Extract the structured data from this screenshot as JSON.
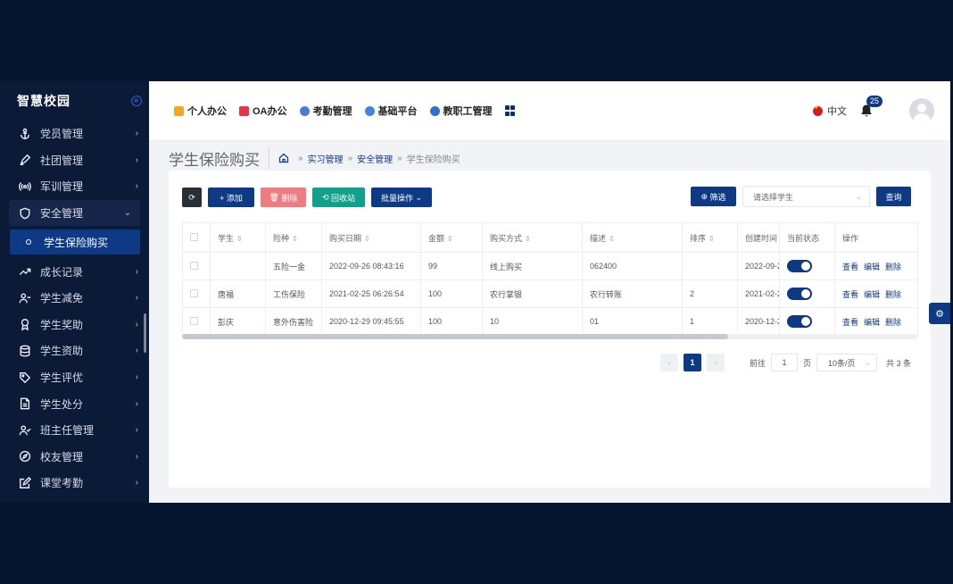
{
  "sidebar": {
    "brand": "智慧校园",
    "items": [
      {
        "label": "党员管理",
        "icon": "anchor-icon"
      },
      {
        "label": "社团管理",
        "icon": "pen-icon"
      },
      {
        "label": "军训管理",
        "icon": "broadcast-icon"
      },
      {
        "label": "安全管理",
        "icon": "shield-icon",
        "open": true
      },
      {
        "label": "成长记录",
        "icon": "trend-icon"
      },
      {
        "label": "学生减免",
        "icon": "user-minus-icon"
      },
      {
        "label": "学生奖助",
        "icon": "award-icon"
      },
      {
        "label": "学生资助",
        "icon": "database-icon"
      },
      {
        "label": "学生评优",
        "icon": "tag-icon"
      },
      {
        "label": "学生处分",
        "icon": "file-icon"
      },
      {
        "label": "班主任管理",
        "icon": "user-check-icon"
      },
      {
        "label": "校友管理",
        "icon": "compass-icon"
      },
      {
        "label": "课堂考勤",
        "icon": "edit-icon"
      }
    ],
    "submenu_active": "学生保险购买"
  },
  "topnav": {
    "items": [
      {
        "label": "个人办公",
        "color": "#f5a623"
      },
      {
        "label": "OA办公",
        "color": "#e8344a"
      },
      {
        "label": "考勤管理",
        "color": "#4a7bd9"
      },
      {
        "label": "基础平台",
        "color": "#3e86e0"
      },
      {
        "label": "教职工管理",
        "color": "#2f6fd0"
      }
    ],
    "lang": "中文",
    "notifications": "25"
  },
  "page": {
    "title": "学生保险购买",
    "breadcrumb": [
      "实习管理",
      "安全管理",
      "学生保险购买"
    ]
  },
  "toolbar": {
    "add": "+ 添加",
    "delete": "删除",
    "recycle": "回收站",
    "batch": "批量操作",
    "filter": "筛选",
    "select_placeholder": "请选择学生",
    "query": "查询"
  },
  "table": {
    "columns": [
      "学生",
      "险种",
      "购买日期",
      "金额",
      "购买方式",
      "描述",
      "排序",
      "创建时间",
      "当前状态",
      "操作"
    ],
    "rows": [
      {
        "student": "",
        "type": "五险一金",
        "date": "2022-09-26 08:43:16",
        "amount": "99",
        "method": "线上购买",
        "desc": "062400",
        "order": "",
        "created": "2022-09-2"
      },
      {
        "student": "唐福",
        "type": "工伤保险",
        "date": "2021-02-25 06:26:54",
        "amount": "100",
        "method": "农行掌银",
        "desc": "农行转账",
        "order": "2",
        "created": "2021-02-2"
      },
      {
        "student": "彭庆",
        "type": "意外伤害险",
        "date": "2020-12-29 09:45:55",
        "amount": "100",
        "method": "10",
        "desc": "01",
        "order": "1",
        "created": "2020-12-2"
      }
    ],
    "actions": [
      "查看",
      "编辑",
      "删除"
    ]
  },
  "pagination": {
    "current": "1",
    "goto_label": "前往",
    "goto_value": "1",
    "page_unit": "页",
    "page_size": "10条/页",
    "total": "共 3 条"
  }
}
